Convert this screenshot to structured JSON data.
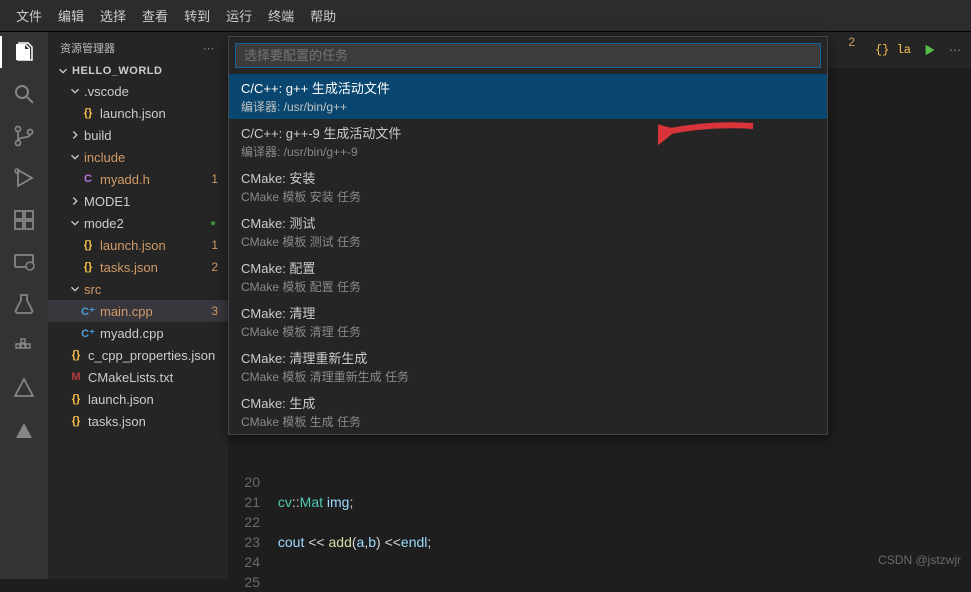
{
  "menu": [
    "文件",
    "编辑",
    "选择",
    "查看",
    "转到",
    "运行",
    "终端",
    "帮助"
  ],
  "sidebar": {
    "title": "资源管理器",
    "project": "HELLO_WORLD",
    "tree": [
      {
        "type": "folder",
        "label": ".vscode",
        "indent": 1,
        "open": true
      },
      {
        "type": "file",
        "label": "launch.json",
        "indent": 2,
        "icon": "json"
      },
      {
        "type": "folder",
        "label": "build",
        "indent": 1,
        "open": false
      },
      {
        "type": "folder",
        "label": "include",
        "indent": 1,
        "open": true,
        "orange": true,
        "badge": ""
      },
      {
        "type": "file",
        "label": "myadd.h",
        "indent": 2,
        "icon": "chead",
        "orange": true,
        "badge": "1"
      },
      {
        "type": "folder",
        "label": "MODE1",
        "indent": 1,
        "open": false
      },
      {
        "type": "folder",
        "label": "mode2",
        "indent": 1,
        "open": true,
        "greendot": true
      },
      {
        "type": "file",
        "label": "launch.json",
        "indent": 2,
        "icon": "json",
        "orange": true,
        "badge": "1"
      },
      {
        "type": "file",
        "label": "tasks.json",
        "indent": 2,
        "icon": "json",
        "orange": true,
        "badge": "2"
      },
      {
        "type": "folder",
        "label": "src",
        "indent": 1,
        "open": true,
        "orange": true,
        "badge": ""
      },
      {
        "type": "file",
        "label": "main.cpp",
        "indent": 2,
        "icon": "cpp",
        "orange": true,
        "badge": "3",
        "selected": true
      },
      {
        "type": "file",
        "label": "myadd.cpp",
        "indent": 2,
        "icon": "cpp"
      },
      {
        "type": "file",
        "label": "c_cpp_properties.json",
        "indent": 1,
        "icon": "json"
      },
      {
        "type": "file",
        "label": "CMakeLists.txt",
        "indent": 1,
        "icon": "cmake"
      },
      {
        "type": "file",
        "label": "launch.json",
        "indent": 1,
        "icon": "json"
      },
      {
        "type": "file",
        "label": "tasks.json",
        "indent": 1,
        "icon": "json"
      }
    ]
  },
  "tabRow": {
    "badge": "2",
    "rightTab": "{} la"
  },
  "dropdown": {
    "placeholder": "选择要配置的任务",
    "items": [
      {
        "main": "C/C++: g++ 生成活动文件",
        "sub": "编译器: /usr/bin/g++",
        "selected": true
      },
      {
        "main": "C/C++: g++-9 生成活动文件",
        "sub": "编译器: /usr/bin/g++-9"
      },
      {
        "main": "CMake: 安装",
        "sub": "CMake 模板 安装 任务"
      },
      {
        "main": "CMake: 测试",
        "sub": "CMake 模板 测试 任务"
      },
      {
        "main": "CMake: 配置",
        "sub": "CMake 模板 配置 任务"
      },
      {
        "main": "CMake: 清理",
        "sub": "CMake 模板 清理 任务"
      },
      {
        "main": "CMake: 清理重新生成",
        "sub": "CMake 模板 清理重新生成 任务"
      },
      {
        "main": "CMake: 生成",
        "sub": "CMake 模板 生成 任务"
      }
    ]
  },
  "code": {
    "lines": [
      {
        "n": "20",
        "html": ""
      },
      {
        "n": "21",
        "html": "        <span class='ns'>cv</span>::<span class='ns'>Mat</span> <span class='var'>img</span>;"
      },
      {
        "n": "22",
        "html": ""
      },
      {
        "n": "23",
        "html": "        <span class='var'>cout</span> &lt;&lt; <span class='fn'>add</span>(<span class='var'>a</span>,<span class='var'>b</span>) &lt;&lt;<span class='var'>endl</span>;"
      },
      {
        "n": "24",
        "html": ""
      },
      {
        "n": "25",
        "html": ""
      }
    ]
  },
  "watermark": "CSDN @jstzwjr"
}
